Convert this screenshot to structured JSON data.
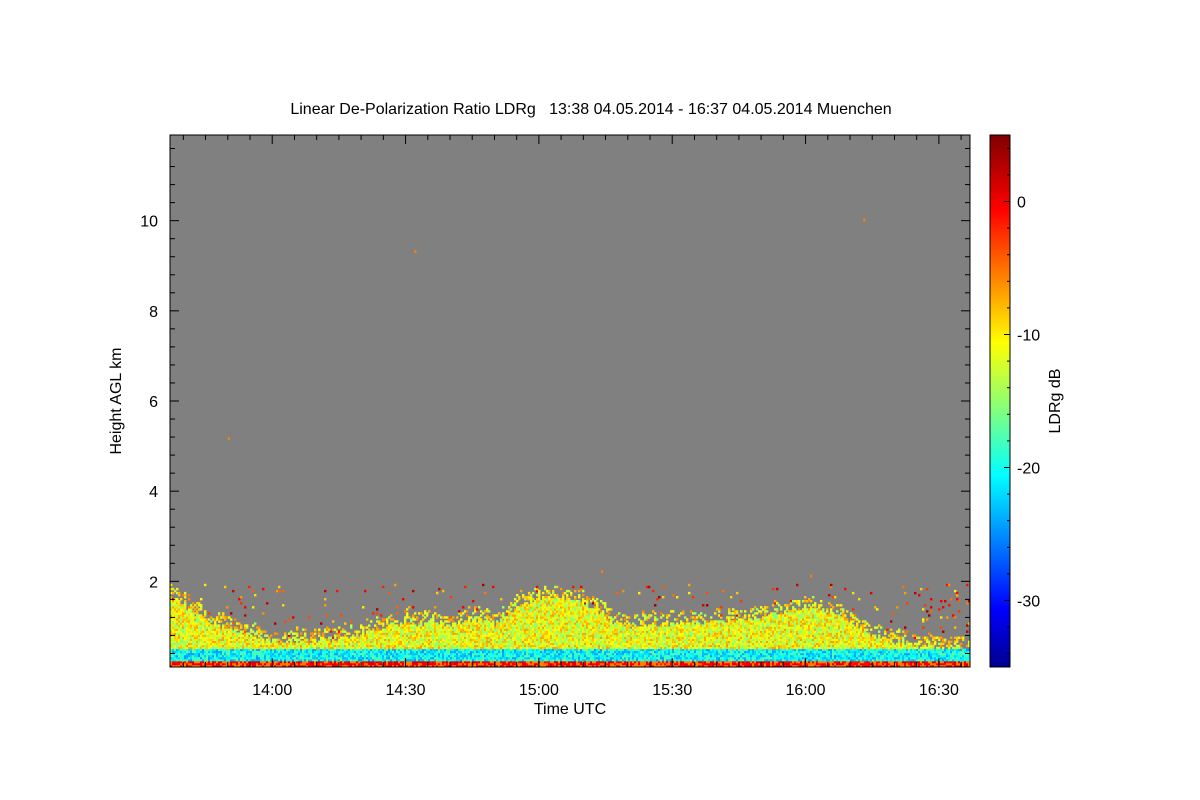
{
  "chart_data": {
    "type": "heatmap",
    "title": "Linear De-Polarization Ratio LDRg   13:38 04.05.2014 - 16:37 04.05.2014 Muenchen",
    "xlabel": "Time UTC",
    "ylabel": "Height AGL km",
    "x_tick_labels": [
      "14:00",
      "14:30",
      "15:00",
      "15:30",
      "16:00",
      "16:30"
    ],
    "x_tick_values_min": [
      840,
      870,
      900,
      930,
      960,
      990
    ],
    "xlim_min": [
      817,
      997
    ],
    "y_tick_labels": [
      "2",
      "4",
      "6",
      "8",
      "10"
    ],
    "y_tick_values": [
      2,
      4,
      6,
      8,
      10
    ],
    "ylim": [
      0.1,
      11.9
    ],
    "colorbar": {
      "label": "LDRg dB",
      "range": [
        -35,
        5
      ],
      "tick_labels": [
        "0",
        "-10",
        "-20",
        "-30"
      ],
      "tick_values": [
        0,
        -10,
        -20,
        -30
      ],
      "colormap": "jet"
    },
    "background_color": "#808080",
    "aerosol_layer_top_km": [
      {
        "t": 817,
        "h": 1.65
      },
      {
        "t": 825,
        "h": 1.1
      },
      {
        "t": 840,
        "h": 0.65
      },
      {
        "t": 855,
        "h": 0.7
      },
      {
        "t": 870,
        "h": 1.05
      },
      {
        "t": 880,
        "h": 1.0
      },
      {
        "t": 885,
        "h": 1.15
      },
      {
        "t": 890,
        "h": 1.05
      },
      {
        "t": 895,
        "h": 1.4
      },
      {
        "t": 902,
        "h": 1.65
      },
      {
        "t": 910,
        "h": 1.5
      },
      {
        "t": 918,
        "h": 1.0
      },
      {
        "t": 930,
        "h": 1.05
      },
      {
        "t": 945,
        "h": 1.1
      },
      {
        "t": 955,
        "h": 1.3
      },
      {
        "t": 962,
        "h": 1.4
      },
      {
        "t": 968,
        "h": 1.2
      },
      {
        "t": 975,
        "h": 0.75
      },
      {
        "t": 985,
        "h": 0.55
      },
      {
        "t": 997,
        "h": 0.5
      }
    ]
  }
}
